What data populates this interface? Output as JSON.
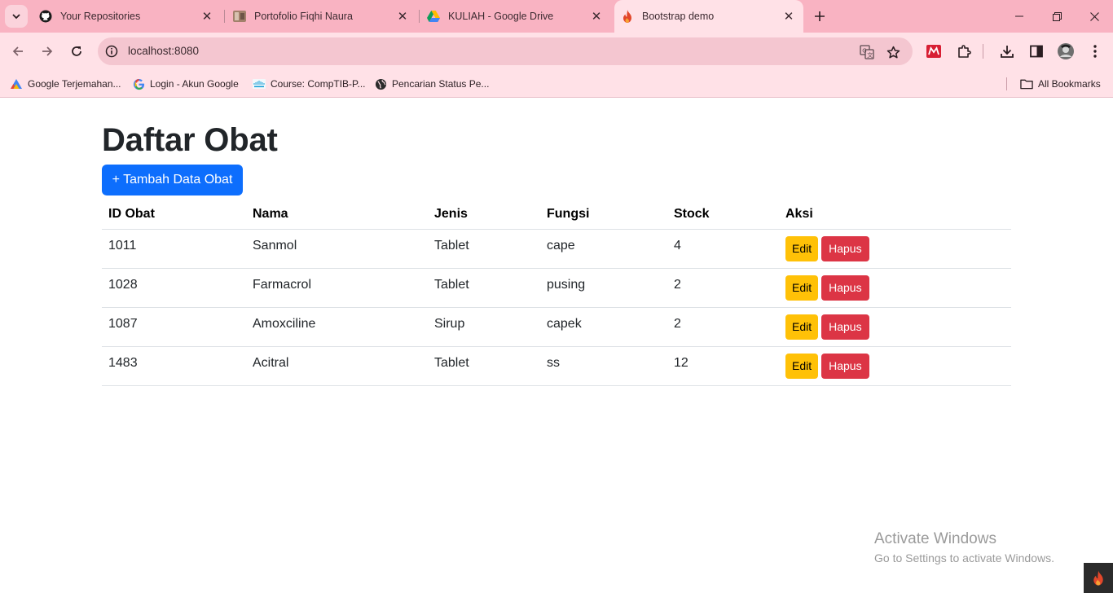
{
  "browser": {
    "tabs": [
      {
        "title": "Your Repositories",
        "icon": "github-icon",
        "active": false
      },
      {
        "title": "Portofolio Fiqhi Naura",
        "icon": "image-thumbnail-icon",
        "active": false
      },
      {
        "title": "KULIAH - Google Drive",
        "icon": "google-drive-icon",
        "active": false
      },
      {
        "title": "Bootstrap demo",
        "icon": "flame-icon",
        "active": true
      }
    ],
    "address": "localhost:8080",
    "bookmarks": [
      {
        "label": "Google Terjemahan...",
        "icon": "translate-icon"
      },
      {
        "label": "Login - Akun Google",
        "icon": "google-icon"
      },
      {
        "label": "Course: CompTIB-P...",
        "icon": "cisco-icon"
      },
      {
        "label": "Pencarian Status Pe...",
        "icon": "globe-icon"
      }
    ],
    "all_bookmarks_label": "All Bookmarks",
    "colors": {
      "tabstrip": "#f9b3c2",
      "toolbar": "#ffe1e7",
      "omnibox": "#f4c6d0"
    }
  },
  "page": {
    "title": "Daftar Obat",
    "add_button": "+ Tambah Data Obat",
    "table": {
      "headers": [
        "ID Obat",
        "Nama",
        "Jenis",
        "Fungsi",
        "Stock",
        "Aksi"
      ],
      "rows": [
        [
          "1011",
          "Sanmol",
          "Tablet",
          "cape",
          "4"
        ],
        [
          "1028",
          "Farmacrol",
          "Tablet",
          "pusing",
          "2"
        ],
        [
          "1087",
          "Amoxciline",
          "Sirup",
          "capek",
          "2"
        ],
        [
          "1483",
          "Acitral",
          "Tablet",
          "ss",
          "12"
        ]
      ],
      "edit_label": "Edit",
      "delete_label": "Hapus"
    },
    "colors": {
      "primary": "#0d6efd",
      "warning": "#ffc107",
      "danger": "#dc3545"
    }
  },
  "watermark": {
    "title": "Activate Windows",
    "subtitle": "Go to Settings to activate Windows."
  }
}
